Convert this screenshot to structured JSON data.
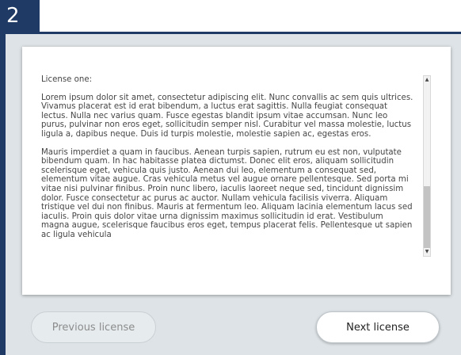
{
  "step": {
    "number": "2"
  },
  "license": {
    "heading": "License one:",
    "paragraph_1": "Lorem ipsum dolor sit amet, consectetur adipiscing elit. Nunc convallis ac sem quis ultrices. Vivamus placerat est id erat bibendum, a luctus erat sagittis. Nulla feugiat consequat lectus. Nulla nec varius quam. Fusce egestas blandit ipsum vitae accumsan. Nunc leo purus, pulvinar non eros eget, sollicitudin semper nisl. Curabitur vel massa molestie, luctus ligula a, dapibus neque. Duis id turpis molestie, molestie sapien ac, egestas eros.",
    "paragraph_2": "Mauris imperdiet a quam in faucibus. Aenean turpis sapien, rutrum eu est non, vulputate bibendum quam. In hac habitasse platea dictumst. Donec elit eros, aliquam sollicitudin scelerisque eget, vehicula quis justo. Aenean dui leo, elementum a consequat sed, elementum vitae augue. Cras vehicula metus vel augue ornare pellentesque. Sed porta mi vitae nisi pulvinar finibus. Proin nunc libero, iaculis laoreet neque sed, tincidunt dignissim dolor. Fusce consectetur ac purus ac auctor. Nullam vehicula facilisis viverra. Aliquam tristique vel dui non finibus. Mauris at fermentum leo. Aliquam lacinia elementum lacus sed iaculis. Proin quis dolor vitae urna dignissim maximus sollicitudin id erat. Vestibulum magna augue, scelerisque faucibus eros eget, tempus placerat felis. Pellentesque ut sapien ac ligula vehicula"
  },
  "scrollbar": {
    "up_icon": "triangle-up",
    "down_icon": "triangle-down"
  },
  "buttons": {
    "previous_label": "Previous license",
    "next_label": "Next license"
  },
  "colors": {
    "frame": "#1f3a64",
    "panel_background": "#dde3e6",
    "card": "#ffffff"
  }
}
